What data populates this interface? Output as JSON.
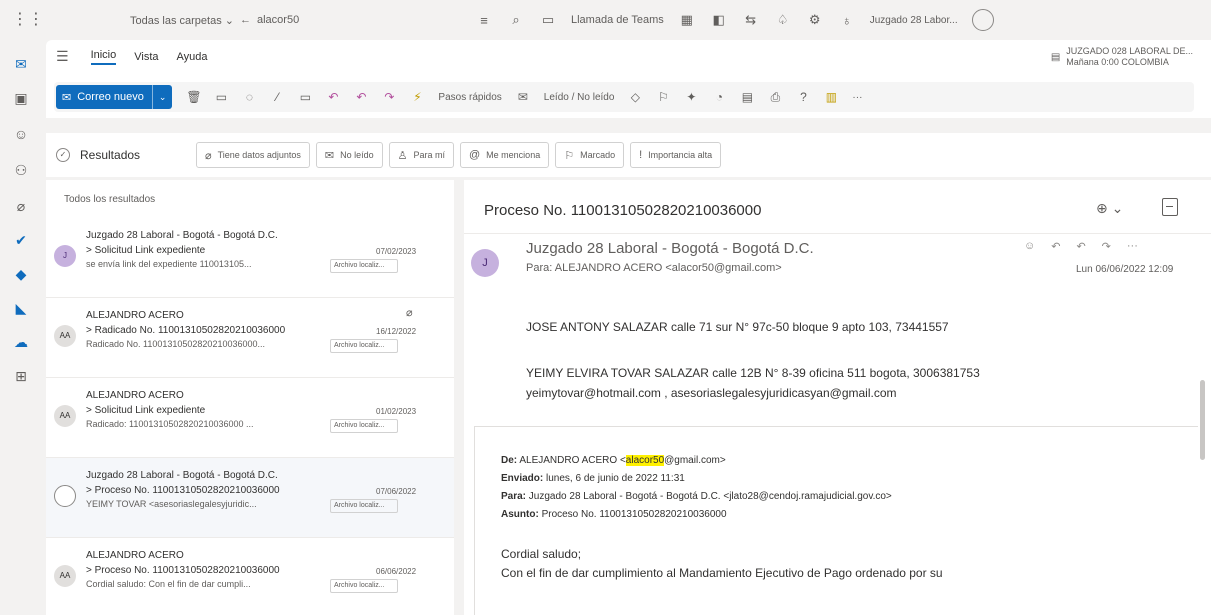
{
  "topbar": {
    "folder_scope": "Todas las carpetas",
    "back_arrow": "←",
    "search_query": "alacor50",
    "teams_label": "Llamada de Teams",
    "user_short": "Juzgado 28 Labor..."
  },
  "ribbon": {
    "tabs": [
      "Inicio",
      "Vista",
      "Ayuda"
    ],
    "org_line1": "JUZGADO 028 LABORAL DE...",
    "org_line2": "Mañana 0:00 COLOMBIA",
    "new_mail": "Correo nuevo",
    "quick_steps": "Pasos rápidos",
    "read_unread": "Leído / No leído",
    "more": "···"
  },
  "filterbar": {
    "results_label": "Resultados",
    "filters": [
      {
        "label": "Tiene datos adjuntos",
        "icon": "paperclip-icon",
        "glyph": "⌀"
      },
      {
        "label": "No leído",
        "icon": "envelope-icon",
        "glyph": "✉"
      },
      {
        "label": "Para mí",
        "icon": "person-icon",
        "glyph": "♙"
      },
      {
        "label": "Me menciona",
        "icon": "at-icon",
        "glyph": "@"
      },
      {
        "label": "Marcado",
        "icon": "flag-icon",
        "glyph": "⚐"
      },
      {
        "label": "Importancia alta",
        "icon": "exclamation-icon",
        "glyph": "!"
      }
    ]
  },
  "list": {
    "header": "Todos los resultados",
    "items": [
      {
        "initials": "J",
        "sender": "Juzgado 28 Laboral - Bogotá - Bogotá D.C.",
        "subject": "> Solicitud Link expediente",
        "preview": "se envía link del expediente 110013105...",
        "date": "07/02/2023",
        "attachment": "Archivo localiz..."
      },
      {
        "initials": "AA",
        "sender": "ALEJANDRO ACERO",
        "subject": "> Radicado No. 11001310502820210036000",
        "preview": "Radicado No. 11001310502820210036000...",
        "date": "16/12/2022",
        "attachment": "Archivo localiz..."
      },
      {
        "initials": "AA",
        "sender": "ALEJANDRO ACERO",
        "subject": "> Solicitud Link expediente",
        "preview": "Radicado: 11001310502820210036000 ...",
        "date": "01/02/2023",
        "attachment": "Archivo localiz..."
      },
      {
        "initials": "",
        "sender": "Juzgado 28 Laboral - Bogotá - Bogotá D.C.",
        "subject": "> Proceso No. 11001310502820210036000",
        "preview": "YEIMY TOVAR <asesoriaslegalesyjuridic...",
        "date": "07/06/2022",
        "attachment": "Archivo localiz..."
      },
      {
        "initials": "AA",
        "sender": "ALEJANDRO ACERO",
        "subject": "> Proceso No. 11001310502820210036000",
        "preview": "Cordial saludo: Con el fin de dar cumpli...",
        "date": "06/06/2022",
        "attachment": "Archivo localiz..."
      }
    ]
  },
  "reading": {
    "subject": "Proceso No. 11001310502820210036000",
    "avatar_initial": "J",
    "from": "Juzgado 28 Laboral - Bogotá - Bogotá D.C.",
    "to": "Para: ALEJANDRO ACERO <alacor50@gmail.com>",
    "date": "Lun 06/06/2022 12:09",
    "body_lines": [
      "JOSE ANTONY SALAZAR calle 71 sur N° 97c-50 bloque 9 apto 103, 73441557",
      "YEIMY ELVIRA TOVAR SALAZAR calle 12B N° 8-39 oficina 511 bogota, 3006381753",
      "yeimytovar@hotmail.com , asesoriaslegalesyjuridicasyan@gmail.com"
    ],
    "quoted": {
      "de_label": "De:",
      "de_name": "ALEJANDRO ACERO <",
      "de_highlight": "alacor50",
      "de_rest": "@gmail.com>",
      "enviado_label": "Enviado:",
      "enviado_value": "lunes, 6 de junio de 2022 11:31",
      "para_label": "Para:",
      "para_value": "Juzgado 28 Laboral - Bogotá - Bogotá D.C. <jlato28@cendoj.ramajudicial.gov.co>",
      "asunto_label": "Asunto:",
      "asunto_value": "Proceso No. 11001310502820210036000",
      "greeting": "Cordial saludo;",
      "first_line": "Con el fin de dar cumplimiento al Mandamiento Ejecutivo de Pago ordenado por su"
    }
  },
  "colors": {
    "accent": "#0f6cbd",
    "highlight": "#fff100",
    "avatar_purple": "#c6b1de"
  }
}
